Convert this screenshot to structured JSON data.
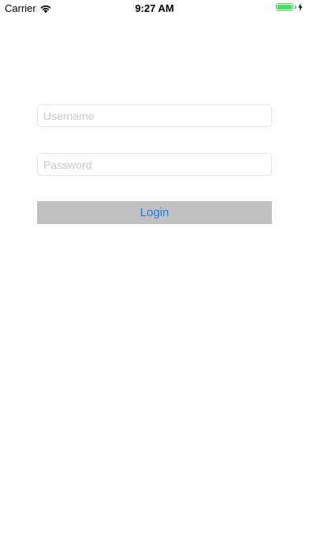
{
  "status_bar": {
    "carrier": "Carrier",
    "time": "9:27 AM",
    "battery_level": 1.0,
    "battery_color": "#4cd964",
    "icons": [
      "wifi-icon",
      "battery-icon",
      "charging-bolt-icon"
    ]
  },
  "form": {
    "username": {
      "value": "",
      "placeholder": "Username"
    },
    "password": {
      "value": "",
      "placeholder": "Password"
    },
    "login_label": "Login",
    "login_text_color": "#1a7ef7",
    "login_background": "#c0c0c0"
  }
}
